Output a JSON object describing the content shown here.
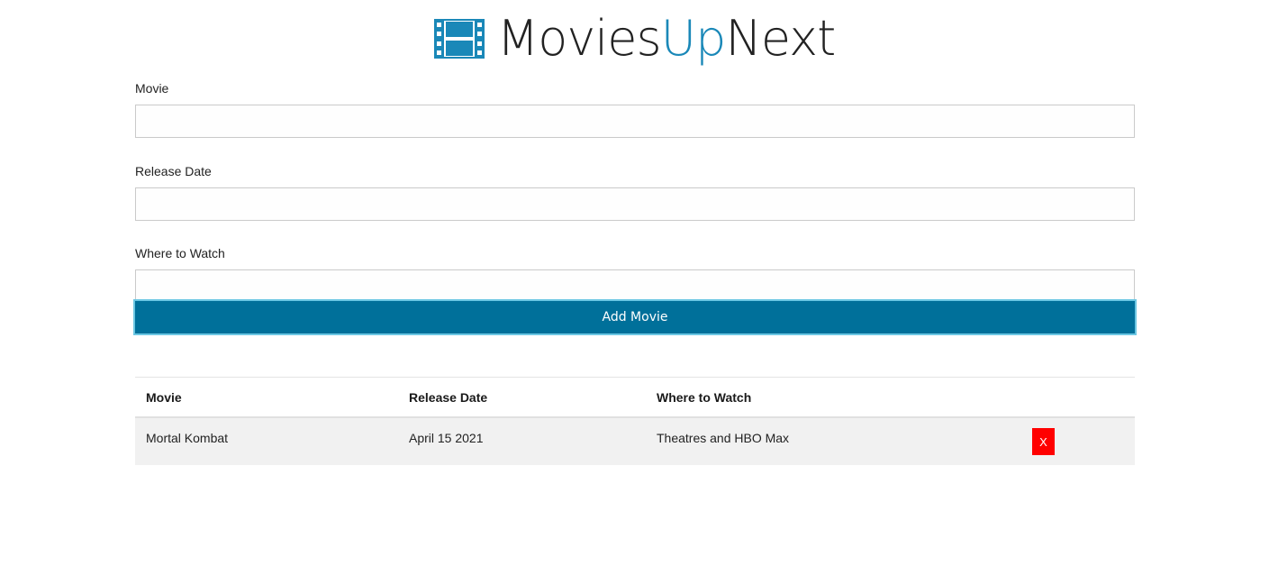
{
  "brand": {
    "title_part1": "Movies",
    "title_accent": "Up",
    "title_part2": "Next",
    "icon": "film-icon",
    "accent_color": "#1a88b8"
  },
  "form": {
    "movie_label": "Movie",
    "movie_value": "",
    "release_label": "Release Date",
    "release_value": "",
    "where_label": "Where to Watch",
    "where_value": "",
    "submit_label": "Add Movie",
    "submit_color": "#00709a"
  },
  "table": {
    "headers": [
      "Movie",
      "Release Date",
      "Where to Watch",
      ""
    ],
    "rows": [
      {
        "movie": "Mortal Kombat",
        "release_date": "April 15 2021",
        "where": "Theatres and HBO Max",
        "delete_label": "X"
      }
    ],
    "delete_color": "#ff0000"
  }
}
